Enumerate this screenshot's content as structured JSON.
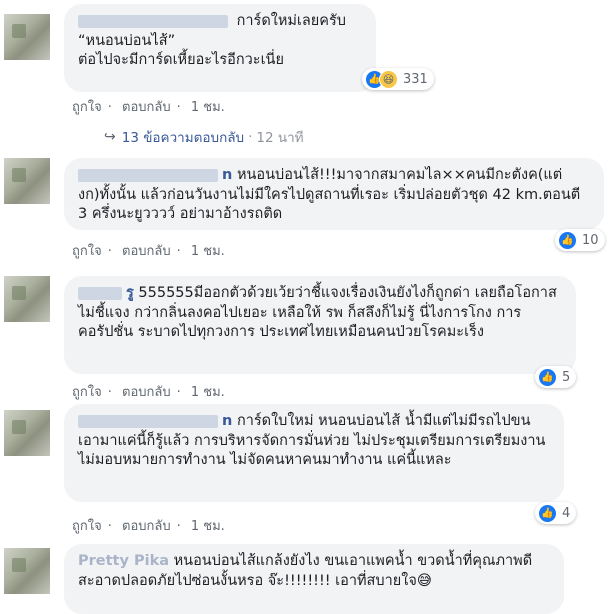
{
  "comments": [
    {
      "name_suffix": "",
      "text": "การ์ดใหม่เลยครับ\n“หนอนบ่อนไส้”\nต่อไปจะมีการ์ดเหี้ยอะไรอีกวะเนี่ย",
      "like_label": "ถูกใจ",
      "reply_label": "ตอบกลับ",
      "time": "1 ชม.",
      "reaction_count": "331",
      "reactions": [
        "like-icon",
        "haha-icon"
      ]
    },
    {
      "name_suffix": "n",
      "text": "หนอนบ่อนไส้!!!มาจากสมาคมไล××คนมีกะตังค(แต่งก)ทั้งนั้น แล้วก่อนวันงานไม่มีใครไปดูสถานที่เรอะ เริ่มปล่อยตัวชุด 42 km.ตอนตี 3 ครึ่งนะยูวววว์ อย่ามาอ้างรถติด",
      "like_label": "ถูกใจ",
      "reply_label": "ตอบกลับ",
      "time": "1 ชม.",
      "reaction_count": "10"
    },
    {
      "name_suffix": "รู",
      "text": "555555มีออกตัวด้วยเว้ยว่าชี้แจงเรื่องเงินยังไงก็ถูกด่า เลยถือโอกาสไม่ชี้แจง กว่ากลิ่นลงคอไปเยอะ เหลือให้ รพ ก็สลึงก็ไม่รู้ นี่ไงการโกง การคอรัปชั่น ระบาดไปทุกวงการ ประเทศไทยเหมือนคนป่วยโรคมะเร็ง",
      "like_label": "ถูกใจ",
      "reply_label": "ตอบกลับ",
      "time": "1 ชม.",
      "reaction_count": "5"
    },
    {
      "name_suffix": "n",
      "text": "การ์ดใบใหม่ หนอนบ่อนไส้ น้ำมีแต่ไม่มีรถไปขนเอามาแค่นี้ก็รู้แล้ว การบริหารจัดการมั่นห่วย ไม่ประชุมเตรียมการเตรียมงาน ไม่มอบหมายการทำงาน ไม่จัดคนหาคนมาทำงาน แค่นี้แหละ",
      "like_label": "ถูกใจ",
      "reply_label": "ตอบกลับ",
      "time": "1 ชม.",
      "reaction_count": "4"
    },
    {
      "name_suffix": "Pretty Pika",
      "text": "หนอนบ่อนไส้แกล้งยังไง ขนเอาแพคน้ำ ขวดน้ำที่คุณภาพดีสะอาดปลอดภัยไปซ่อนงั้นหรอ จ๊ะ!!!!!!!! เอาที่สบายใจ😅",
      "like_label": "",
      "reply_label": "",
      "time": ""
    }
  ],
  "replies_link": {
    "label": "13 ข้อความตอบกลับ",
    "time": "12 นาที"
  },
  "separator": "·",
  "colors": {
    "bubble": "#f2f3f5",
    "link": "#385898",
    "like_blue": "#1877f2"
  }
}
